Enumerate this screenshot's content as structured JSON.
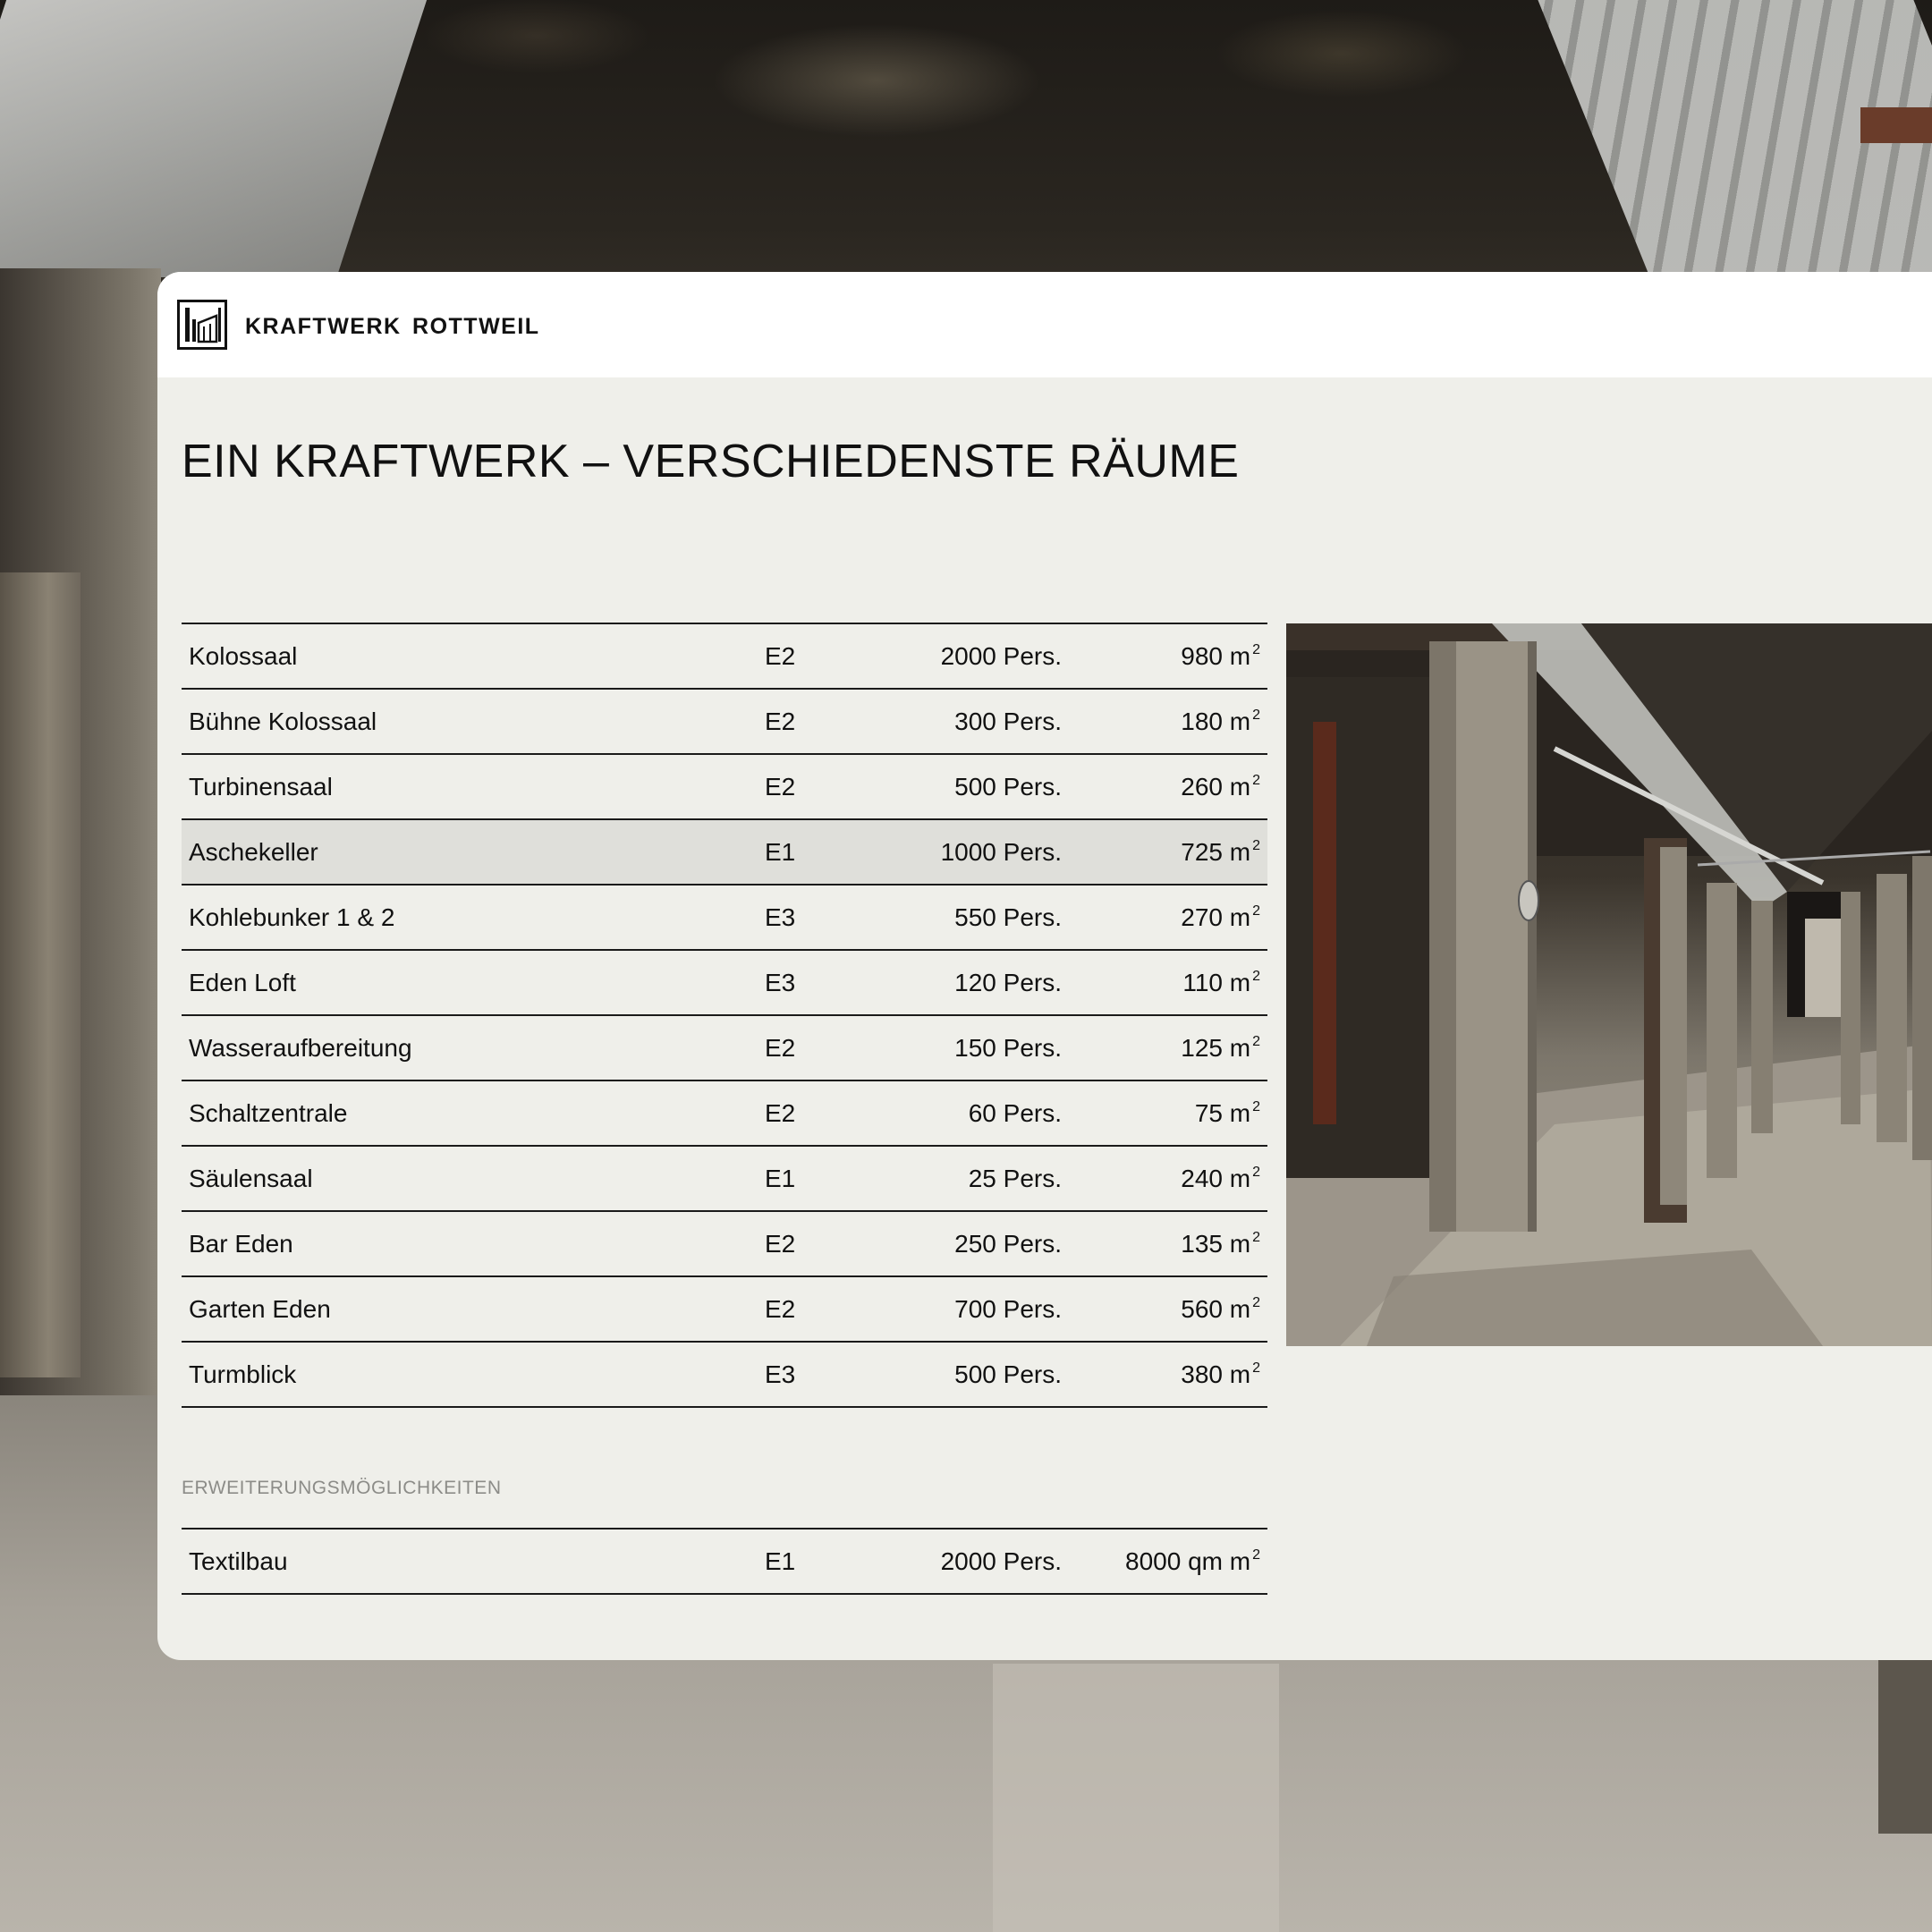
{
  "brand": {
    "name": "KRAFTWERK ROTTWEIL",
    "logo_icon": "kraftwerk-logo-icon"
  },
  "page": {
    "title": "EIN KRAFTWERK – VERSCHIEDENSTE RÄUME"
  },
  "rooms": [
    {
      "name": "Kolossaal",
      "level": "E2",
      "persons": "2000 Pers.",
      "area": "980 m",
      "unit_sup": "2"
    },
    {
      "name": "Bühne Kolossaal",
      "level": "E2",
      "persons": "300 Pers.",
      "area": "180 m",
      "unit_sup": "2"
    },
    {
      "name": "Turbinensaal",
      "level": "E2",
      "persons": "500 Pers.",
      "area": "260 m",
      "unit_sup": "2"
    },
    {
      "name": "Aschekeller",
      "level": "E1",
      "persons": "1000 Pers.",
      "area": "725 m",
      "unit_sup": "2",
      "highlighted": true
    },
    {
      "name": "Kohlebunker 1 & 2",
      "level": "E3",
      "persons": "550 Pers.",
      "area": "270 m",
      "unit_sup": "2"
    },
    {
      "name": "Eden Loft",
      "level": "E3",
      "persons": "120 Pers.",
      "area": "110 m",
      "unit_sup": "2"
    },
    {
      "name": "Wasseraufbereitung",
      "level": "E2",
      "persons": "150 Pers.",
      "area": "125 m",
      "unit_sup": "2"
    },
    {
      "name": "Schaltzentrale",
      "level": "E2",
      "persons": "60 Pers.",
      "area": "75 m",
      "unit_sup": "2"
    },
    {
      "name": "Säulensaal",
      "level": "E1",
      "persons": "25 Pers.",
      "area": "240 m",
      "unit_sup": "2"
    },
    {
      "name": "Bar Eden",
      "level": "E2",
      "persons": "250 Pers.",
      "area": "135 m",
      "unit_sup": "2"
    },
    {
      "name": "Garten Eden",
      "level": "E2",
      "persons": "700 Pers.",
      "area": "560 m",
      "unit_sup": "2"
    },
    {
      "name": "Turmblick",
      "level": "E3",
      "persons": "500 Pers.",
      "area": "380 m",
      "unit_sup": "2"
    }
  ],
  "extension": {
    "label": "ERWEITERUNGSMÖGLICHKEITEN",
    "rooms": [
      {
        "name": "Textilbau",
        "level": "E1",
        "persons": "2000 Pers.",
        "area": "8000 qm m",
        "unit_sup": "2"
      }
    ]
  },
  "colors": {
    "card_bg": "#efefea",
    "header_bg": "#ffffff",
    "highlight_row": "#dfdfda",
    "rule": "#1a1a1a",
    "muted_label": "#8c8c88"
  }
}
